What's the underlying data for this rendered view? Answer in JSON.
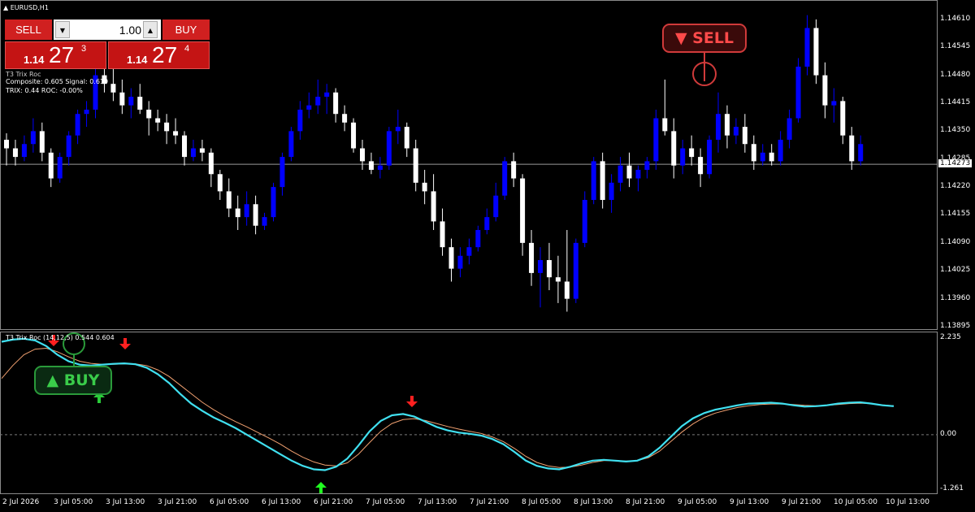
{
  "chart": {
    "symbol_label": "EURUSD,H1",
    "current_price": "1.14273",
    "price_axis": [
      "1.14610",
      "1.14545",
      "1.14480",
      "1.14415",
      "1.14350",
      "1.14285",
      "1.14220",
      "1.14155",
      "1.14090",
      "1.14025",
      "1.13960",
      "1.13895"
    ],
    "time_axis": [
      "2 Jul 2026",
      "3 Jul 05:00",
      "3 Jul 13:00",
      "3 Jul 21:00",
      "6 Jul 05:00",
      "6 Jul 13:00",
      "6 Jul 21:00",
      "7 Jul 05:00",
      "7 Jul 13:00",
      "7 Jul 21:00",
      "8 Jul 05:00",
      "8 Jul 13:00",
      "8 Jul 21:00",
      "9 Jul 05:00",
      "9 Jul 13:00",
      "9 Jul 21:00",
      "10 Jul 05:00",
      "10 Jul 13:00"
    ],
    "colors": {
      "bull": "#0000ff",
      "bear": "#ffffff",
      "grid": "#8a8a8a",
      "trix": "#40e0f0",
      "signal": "#f0a070"
    }
  },
  "trade_panel": {
    "sell_label": "SELL",
    "buy_label": "BUY",
    "lot_value": "1.00",
    "bid": {
      "prefix": "1.14",
      "big": "27",
      "sup": "3"
    },
    "ask": {
      "prefix": "1.14",
      "big": "27",
      "sup": "4"
    }
  },
  "indicator_info": {
    "name": "T3 Trix Roc",
    "line1": "Composite: 0.605  Signal: 0.619",
    "line2": "TRIX: 0.44  ROC: -0.00%"
  },
  "indicator_pane": {
    "title": "T3 Trix Roc (14,12,5) 0.544 0.604",
    "scale": [
      "2.235",
      "0.00",
      "-1.261"
    ]
  },
  "signals": {
    "sell_badge": "▼ SELL",
    "buy_badge": "▲ BUY"
  },
  "chart_data": {
    "type": "line",
    "series": [],
    "candles_ohlc": [
      [
        1.1433,
        1.14345,
        1.1427,
        1.1431
      ],
      [
        1.1431,
        1.1433,
        1.1427,
        1.1429
      ],
      [
        1.1429,
        1.1434,
        1.1428,
        1.1432
      ],
      [
        1.1432,
        1.1438,
        1.143,
        1.1435
      ],
      [
        1.1435,
        1.1437,
        1.1428,
        1.143
      ],
      [
        1.143,
        1.1431,
        1.1422,
        1.1424
      ],
      [
        1.1424,
        1.143,
        1.1423,
        1.1429
      ],
      [
        1.1429,
        1.1435,
        1.1427,
        1.1434
      ],
      [
        1.1434,
        1.144,
        1.1432,
        1.1439
      ],
      [
        1.1439,
        1.1442,
        1.1436,
        1.144
      ],
      [
        1.144,
        1.1452,
        1.1438,
        1.1448
      ],
      [
        1.1448,
        1.1453,
        1.1444,
        1.1446
      ],
      [
        1.1446,
        1.145,
        1.1442,
        1.1444
      ],
      [
        1.1444,
        1.1447,
        1.1439,
        1.1441
      ],
      [
        1.1441,
        1.1445,
        1.1438,
        1.1443
      ],
      [
        1.1443,
        1.1446,
        1.1439,
        1.144
      ],
      [
        1.144,
        1.1442,
        1.1434,
        1.1438
      ],
      [
        1.1438,
        1.144,
        1.1435,
        1.1437
      ],
      [
        1.1437,
        1.1439,
        1.1432,
        1.1435
      ],
      [
        1.1435,
        1.1438,
        1.1432,
        1.1434
      ],
      [
        1.1434,
        1.1435,
        1.1427,
        1.1429
      ],
      [
        1.1429,
        1.1433,
        1.1428,
        1.1431
      ],
      [
        1.1431,
        1.1433,
        1.1428,
        1.143
      ],
      [
        1.143,
        1.1431,
        1.1422,
        1.1425
      ],
      [
        1.1425,
        1.1426,
        1.1419,
        1.1421
      ],
      [
        1.1421,
        1.1424,
        1.1415,
        1.1417
      ],
      [
        1.1417,
        1.142,
        1.1412,
        1.1415
      ],
      [
        1.1415,
        1.1421,
        1.1413,
        1.1418
      ],
      [
        1.1418,
        1.142,
        1.1411,
        1.1413
      ],
      [
        1.1413,
        1.1416,
        1.1412,
        1.1415
      ],
      [
        1.1415,
        1.1423,
        1.1414,
        1.1422
      ],
      [
        1.1422,
        1.143,
        1.142,
        1.1429
      ],
      [
        1.1429,
        1.1436,
        1.1428,
        1.1435
      ],
      [
        1.1435,
        1.1442,
        1.1433,
        1.144
      ],
      [
        1.144,
        1.1444,
        1.1438,
        1.1441
      ],
      [
        1.1441,
        1.1447,
        1.1439,
        1.1443
      ],
      [
        1.1443,
        1.1446,
        1.1439,
        1.1444
      ],
      [
        1.1444,
        1.1445,
        1.1437,
        1.1439
      ],
      [
        1.1439,
        1.1441,
        1.1435,
        1.1437
      ],
      [
        1.1437,
        1.1438,
        1.143,
        1.1431
      ],
      [
        1.1431,
        1.1433,
        1.1426,
        1.1428
      ],
      [
        1.1428,
        1.143,
        1.1425,
        1.1426
      ],
      [
        1.1426,
        1.1429,
        1.1424,
        1.1427
      ],
      [
        1.1427,
        1.1436,
        1.1426,
        1.1435
      ],
      [
        1.1435,
        1.144,
        1.1432,
        1.1436
      ],
      [
        1.1436,
        1.1437,
        1.1429,
        1.1431
      ],
      [
        1.1431,
        1.1433,
        1.1421,
        1.1423
      ],
      [
        1.1423,
        1.1426,
        1.1418,
        1.1421
      ],
      [
        1.1421,
        1.1425,
        1.1412,
        1.1414
      ],
      [
        1.1414,
        1.1417,
        1.1406,
        1.1408
      ],
      [
        1.1408,
        1.141,
        1.14,
        1.1403
      ],
      [
        1.1403,
        1.1408,
        1.1401,
        1.1406
      ],
      [
        1.1406,
        1.141,
        1.1404,
        1.1408
      ],
      [
        1.1408,
        1.1413,
        1.1407,
        1.1412
      ],
      [
        1.1412,
        1.1417,
        1.1411,
        1.1415
      ],
      [
        1.1415,
        1.1423,
        1.1414,
        1.142
      ],
      [
        1.142,
        1.1429,
        1.1419,
        1.1428
      ],
      [
        1.1428,
        1.143,
        1.1422,
        1.1424
      ],
      [
        1.1424,
        1.1425,
        1.1406,
        1.1409
      ],
      [
        1.1409,
        1.1412,
        1.1399,
        1.1402
      ],
      [
        1.1402,
        1.1408,
        1.1394,
        1.1405
      ],
      [
        1.1405,
        1.1409,
        1.1398,
        1.1401
      ],
      [
        1.1401,
        1.1406,
        1.1395,
        1.14
      ],
      [
        1.14,
        1.1412,
        1.1393,
        1.1396
      ],
      [
        1.1396,
        1.141,
        1.1395,
        1.1409
      ],
      [
        1.1409,
        1.1421,
        1.1408,
        1.1419
      ],
      [
        1.1419,
        1.1429,
        1.1418,
        1.1428
      ],
      [
        1.1428,
        1.143,
        1.1417,
        1.1419
      ],
      [
        1.1419,
        1.1425,
        1.1416,
        1.1423
      ],
      [
        1.1423,
        1.1429,
        1.1421,
        1.1427
      ],
      [
        1.1427,
        1.143,
        1.1422,
        1.1424
      ],
      [
        1.1424,
        1.1427,
        1.1421,
        1.1426
      ],
      [
        1.1426,
        1.1429,
        1.1424,
        1.1428
      ],
      [
        1.1428,
        1.144,
        1.1426,
        1.1438
      ],
      [
        1.1438,
        1.1447,
        1.1434,
        1.1435
      ],
      [
        1.1435,
        1.1438,
        1.1424,
        1.1427
      ],
      [
        1.1427,
        1.1433,
        1.1425,
        1.1431
      ],
      [
        1.1431,
        1.1434,
        1.1427,
        1.1429
      ],
      [
        1.1429,
        1.1431,
        1.1422,
        1.1425
      ],
      [
        1.1425,
        1.1434,
        1.1424,
        1.1433
      ],
      [
        1.1433,
        1.1444,
        1.143,
        1.1439
      ],
      [
        1.1439,
        1.1441,
        1.1431,
        1.1434
      ],
      [
        1.1434,
        1.1438,
        1.1432,
        1.1436
      ],
      [
        1.1436,
        1.1439,
        1.143,
        1.1432
      ],
      [
        1.1432,
        1.1434,
        1.1426,
        1.1428
      ],
      [
        1.1428,
        1.1432,
        1.1427,
        1.143
      ],
      [
        1.143,
        1.1432,
        1.1427,
        1.1428
      ],
      [
        1.1428,
        1.1435,
        1.1427,
        1.1433
      ],
      [
        1.1433,
        1.144,
        1.1431,
        1.1438
      ],
      [
        1.1438,
        1.1452,
        1.1437,
        1.145
      ],
      [
        1.145,
        1.1462,
        1.1448,
        1.1459
      ],
      [
        1.1459,
        1.1461,
        1.1446,
        1.1448
      ],
      [
        1.1448,
        1.1451,
        1.1438,
        1.1441
      ],
      [
        1.1441,
        1.1445,
        1.1437,
        1.1442
      ],
      [
        1.1442,
        1.1443,
        1.1432,
        1.1434
      ],
      [
        1.1434,
        1.1436,
        1.1426,
        1.1428
      ],
      [
        1.1428,
        1.1434,
        1.1427,
        1.1432
      ]
    ],
    "trix_values": [
      2.15,
      2.2,
      2.22,
      2.18,
      2.05,
      1.85,
      1.7,
      1.62,
      1.6,
      1.62,
      1.64,
      1.65,
      1.63,
      1.55,
      1.4,
      1.2,
      0.95,
      0.72,
      0.55,
      0.4,
      0.28,
      0.15,
      0.0,
      -0.15,
      -0.3,
      -0.45,
      -0.6,
      -0.72,
      -0.8,
      -0.82,
      -0.74,
      -0.55,
      -0.25,
      0.08,
      0.32,
      0.45,
      0.48,
      0.42,
      0.3,
      0.18,
      0.1,
      0.05,
      0.02,
      -0.02,
      -0.1,
      -0.22,
      -0.4,
      -0.6,
      -0.72,
      -0.78,
      -0.8,
      -0.74,
      -0.66,
      -0.6,
      -0.58,
      -0.6,
      -0.62,
      -0.6,
      -0.5,
      -0.3,
      -0.05,
      0.2,
      0.38,
      0.5,
      0.58,
      0.63,
      0.68,
      0.72,
      0.73,
      0.74,
      0.72,
      0.68,
      0.65,
      0.66,
      0.68,
      0.72,
      0.74,
      0.75,
      0.72,
      0.68,
      0.66
    ],
    "signal_values": [
      1.3,
      1.6,
      1.85,
      1.98,
      2.0,
      1.92,
      1.8,
      1.7,
      1.65,
      1.63,
      1.63,
      1.64,
      1.64,
      1.6,
      1.5,
      1.35,
      1.15,
      0.95,
      0.75,
      0.58,
      0.43,
      0.3,
      0.18,
      0.05,
      -0.08,
      -0.22,
      -0.38,
      -0.52,
      -0.63,
      -0.7,
      -0.72,
      -0.65,
      -0.45,
      -0.18,
      0.08,
      0.26,
      0.35,
      0.37,
      0.33,
      0.26,
      0.19,
      0.13,
      0.08,
      0.03,
      -0.05,
      -0.16,
      -0.32,
      -0.5,
      -0.64,
      -0.72,
      -0.76,
      -0.75,
      -0.7,
      -0.64,
      -0.6,
      -0.6,
      -0.61,
      -0.6,
      -0.53,
      -0.38,
      -0.16,
      0.06,
      0.25,
      0.4,
      0.5,
      0.57,
      0.63,
      0.67,
      0.7,
      0.71,
      0.71,
      0.7,
      0.68,
      0.67,
      0.68,
      0.7,
      0.72,
      0.73,
      0.72,
      0.69,
      0.67
    ],
    "ylim_price": [
      1.13895,
      1.1464
    ],
    "ylim_indicator": [
      -1.261,
      2.235
    ]
  }
}
